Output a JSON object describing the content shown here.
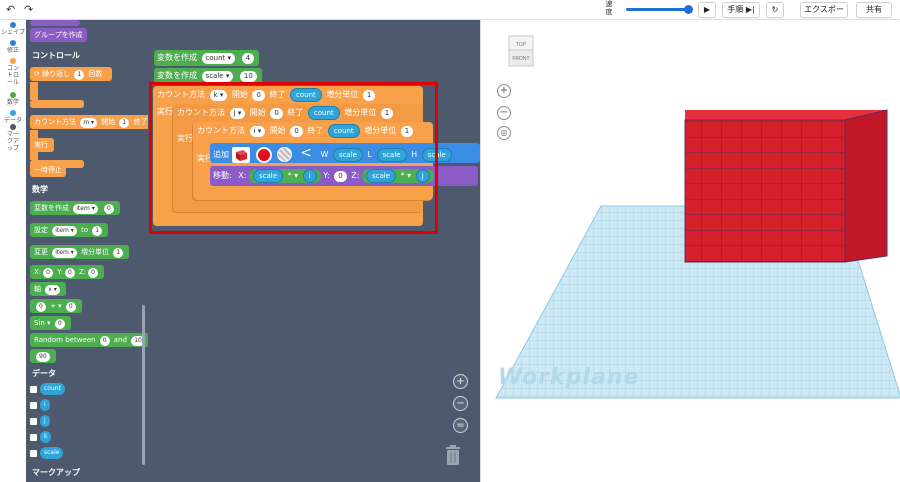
{
  "topbar": {
    "undo_icon": "undo-arrow-icon",
    "redo_icon": "redo-arrow-icon",
    "speed_label": "速度",
    "speed_value": 0.95,
    "play_icon": "play-icon",
    "step_label": "手順",
    "step_icon": "step-icon",
    "reset_icon": "reset-icon",
    "export_label": "エクスポート",
    "share_label": "共有"
  },
  "categories": [
    {
      "label": "シェイプ",
      "color": "#2f7ed8"
    },
    {
      "label": "修正",
      "color": "#2f7ed8"
    },
    {
      "label": "コントロール",
      "color": "#f8a04a"
    },
    {
      "label": "数学",
      "color": "#4cae4f"
    },
    {
      "label": "データ",
      "color": "#2fa4d9"
    },
    {
      "label": "マークアップ",
      "color": "#555555"
    }
  ],
  "flyout": {
    "group_label": "グループを作成",
    "control_title": "コントロール",
    "repeat_label": "繰り返し",
    "repeat_count": "1",
    "repeat_unit": "回数",
    "count_label": "カウント方法",
    "count_var": "m",
    "count_from_label": "開始",
    "count_from": "1",
    "count_to_label": "終了",
    "do_label": "実行",
    "pause_label": "一時停止",
    "math_title": "数学",
    "var_create_label": "変数を作成",
    "var_create_name": "item",
    "var_create_value": "0",
    "set_label": "設定",
    "set_name": "item",
    "set_to": "to",
    "set_value": "1",
    "change_label": "変更",
    "change_name": "item",
    "change_step_label": "増分単位",
    "change_value": "1",
    "xyz_x": "X:",
    "xyz_x_val": "0",
    "xyz_y": "Y:",
    "xyz_y_val": "0",
    "xyz_z": "Z:",
    "xyz_z_val": "0",
    "axis_label": "軸",
    "axis_value": "x",
    "arith_left": "0",
    "arith_op": "+",
    "arith_right": "0",
    "sin_label": "Sin",
    "sin_value": "0",
    "random_label": "Random between",
    "random_min": "0",
    "random_and": "and",
    "random_max": "10",
    "number_value": "90",
    "data_title": "データ",
    "data_vars": [
      "count",
      "i",
      "j",
      "k",
      "scale"
    ],
    "markup_title": "マークアップ"
  },
  "workspace": {
    "var1_label": "変数を作成",
    "var1_name": "count",
    "var1_value": "4",
    "var2_label": "変数を作成",
    "var2_name": "scale",
    "var2_value": "10",
    "loop_label": "カウント方法",
    "from_label": "開始",
    "to_label": "終了",
    "step_label": "増分単位",
    "do_label": "実行",
    "loop1_var": "k",
    "loop1_from": "0",
    "loop1_to": "count",
    "loop1_step": "1",
    "loop2_var": "j",
    "loop2_from": "0",
    "loop2_to": "count",
    "loop2_step": "1",
    "loop3_var": "i",
    "loop3_from": "0",
    "loop3_to": "count",
    "loop3_step": "1",
    "add_label": "追加",
    "add_w_label": "W",
    "add_w_value": "scale",
    "add_l_label": "L",
    "add_l_value": "scale",
    "add_h_label": "H",
    "add_h_value": "scale",
    "add_arrow": "<",
    "move_label": "移動:",
    "move_x_label": "X:",
    "move_x_left": "scale",
    "move_x_op": "*",
    "move_x_right": "i",
    "move_y_label": "Y:",
    "move_y_value": "0",
    "move_z_label": "Z:",
    "move_z_left": "scale",
    "move_z_op": "*",
    "move_z_right": "j",
    "zoom_in_icon": "zoom-in-icon",
    "zoom_out_icon": "zoom-out-icon",
    "center_icon": "recenter-icon",
    "trash_icon": "trash-icon"
  },
  "viewport": {
    "cube_top": "TOP",
    "cube_front": "FRONT",
    "zoom_in_icon": "plus-icon",
    "zoom_out_icon": "minus-icon",
    "fit_icon": "fit-view-icon",
    "workplane_label": "Workplane",
    "cube_color": "#d81f2c",
    "grid_color": "#a8d8ea"
  }
}
